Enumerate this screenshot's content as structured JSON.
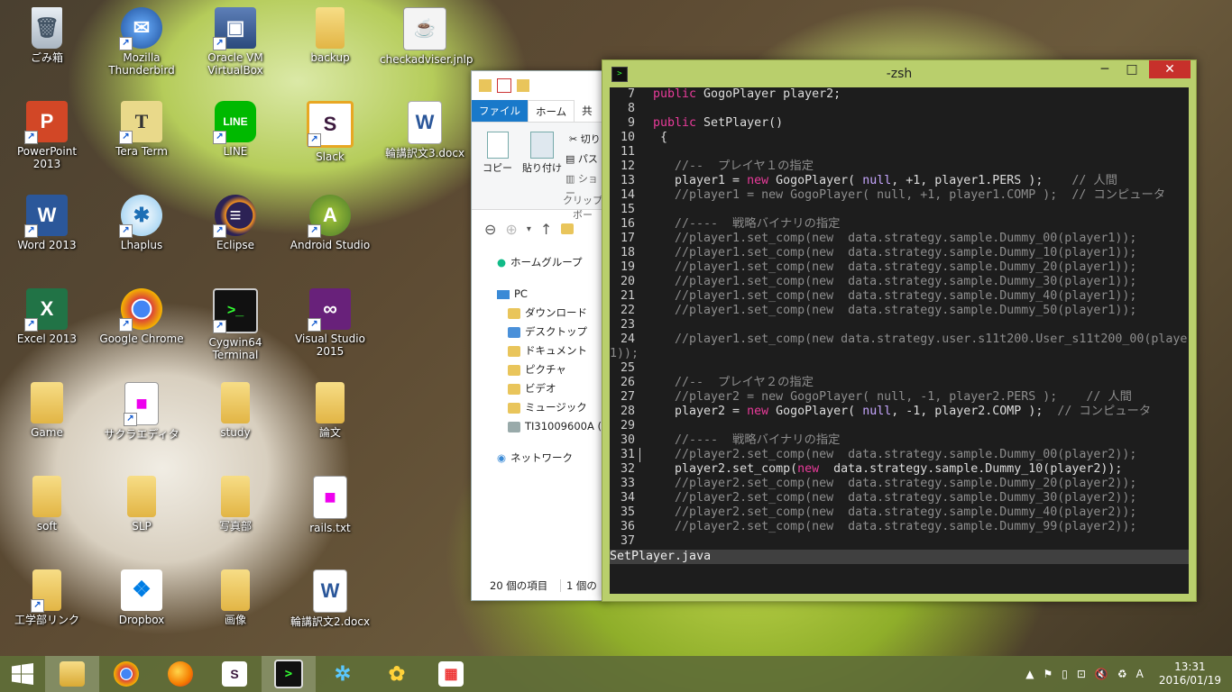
{
  "desktop_icons": [
    {
      "label": "ごみ箱",
      "icon": "recycle-bin-icon"
    },
    {
      "label": "Mozilla Thunderbird",
      "icon": "thunderbird-icon"
    },
    {
      "label": "Oracle VM VirtualBox",
      "icon": "virtualbox-icon"
    },
    {
      "label": "backup",
      "icon": "folder-icon"
    },
    {
      "label": "checkadviser.jnlp",
      "icon": "java-icon"
    },
    {
      "label": "PowerPoint 2013",
      "icon": "powerpoint-icon"
    },
    {
      "label": "Tera Term",
      "icon": "teraterm-icon"
    },
    {
      "label": "LINE",
      "icon": "line-icon"
    },
    {
      "label": "Slack",
      "icon": "slack-icon"
    },
    {
      "label": "輪講訳文3.docx",
      "icon": "word-doc-icon"
    },
    {
      "label": "Word 2013",
      "icon": "word-icon"
    },
    {
      "label": "Lhaplus",
      "icon": "lhaplus-icon"
    },
    {
      "label": "Eclipse",
      "icon": "eclipse-icon"
    },
    {
      "label": "Android Studio",
      "icon": "android-studio-icon"
    },
    {
      "label": "Excel 2013",
      "icon": "excel-icon"
    },
    {
      "label": "Google Chrome",
      "icon": "chrome-icon"
    },
    {
      "label": "Cygwin64 Terminal",
      "icon": "cygwin-icon"
    },
    {
      "label": "Visual Studio 2015",
      "icon": "visual-studio-icon"
    },
    {
      "label": "Game",
      "icon": "folder-icon"
    },
    {
      "label": "サクラエディタ",
      "icon": "sakura-editor-icon"
    },
    {
      "label": "study",
      "icon": "folder-icon"
    },
    {
      "label": "論文",
      "icon": "folder-icon"
    },
    {
      "label": "soft",
      "icon": "folder-icon"
    },
    {
      "label": "SLP",
      "icon": "folder-icon"
    },
    {
      "label": "写真部",
      "icon": "folder-icon"
    },
    {
      "label": "rails.txt",
      "icon": "text-file-icon"
    },
    {
      "label": "工学部リンク",
      "icon": "folder-icon"
    },
    {
      "label": "Dropbox",
      "icon": "dropbox-icon"
    },
    {
      "label": "画像",
      "icon": "folder-icon"
    },
    {
      "label": "輪講訳文2.docx",
      "icon": "word-doc-icon"
    }
  ],
  "explorer": {
    "tabs": [
      "ファイル",
      "ホーム",
      "共"
    ],
    "ribbon": {
      "copy": "コピー",
      "paste": "貼り付け",
      "cut": "切り",
      "path": "パス",
      "shortcut": "ショー",
      "group": "クリップボー"
    },
    "homegroup": "ホームグループ",
    "pc": "PC",
    "tree": [
      "ダウンロード",
      "デスクトップ",
      "ドキュメント",
      "ピクチャ",
      "ビデオ",
      "ミュージック",
      "TI31009600A ("
    ],
    "network": "ネットワーク",
    "status_count": "20 個の項目",
    "status_selected": "1 個の"
  },
  "terminal": {
    "title": "-zsh",
    "status_file": "SetPlayer.java",
    "lines": [
      {
        "n": "7",
        "t": "public GogoPlayer player2;"
      },
      {
        "n": "8",
        "t": ""
      },
      {
        "n": "9",
        "t": "public SetPlayer()"
      },
      {
        "n": "10",
        "t": " {"
      },
      {
        "n": "11",
        "t": ""
      },
      {
        "n": "12",
        "t": "   //--  プレイヤ１の指定"
      },
      {
        "n": "13",
        "t": "   player1 = new GogoPlayer( null, +1, player1.PERS );    // 人間"
      },
      {
        "n": "14",
        "t": "   //player1 = new GogoPlayer( null, +1, player1.COMP );  // コンピュータ"
      },
      {
        "n": "15",
        "t": ""
      },
      {
        "n": "16",
        "t": "   //----  戦略バイナリの指定"
      },
      {
        "n": "17",
        "t": "   //player1.set_comp(new  data.strategy.sample.Dummy_00(player1));"
      },
      {
        "n": "18",
        "t": "   //player1.set_comp(new  data.strategy.sample.Dummy_10(player1));"
      },
      {
        "n": "19",
        "t": "   //player1.set_comp(new  data.strategy.sample.Dummy_20(player1));"
      },
      {
        "n": "20",
        "t": "   //player1.set_comp(new  data.strategy.sample.Dummy_30(player1));"
      },
      {
        "n": "21",
        "t": "   //player1.set_comp(new  data.strategy.sample.Dummy_40(player1));"
      },
      {
        "n": "22",
        "t": "   //player1.set_comp(new  data.strategy.sample.Dummy_50(player1));"
      },
      {
        "n": "23",
        "t": ""
      },
      {
        "n": "24",
        "t": "   //player1.set_comp(new data.strategy.user.s11t200.User_s11t200_00(player"
      },
      {
        "n": "",
        "t": "1));"
      },
      {
        "n": "25",
        "t": ""
      },
      {
        "n": "26",
        "t": "   //--  プレイヤ２の指定"
      },
      {
        "n": "27",
        "t": "   //player2 = new GogoPlayer( null, -1, player2.PERS );    // 人間"
      },
      {
        "n": "28",
        "t": "   player2 = new GogoPlayer( null, -1, player2.COMP );  // コンピュータ"
      },
      {
        "n": "29",
        "t": ""
      },
      {
        "n": "30",
        "t": "   //----  戦略バイナリの指定"
      },
      {
        "n": "31",
        "t": "   //player2.set_comp(new  data.strategy.sample.Dummy_00(player2));"
      },
      {
        "n": "32",
        "t": "   player2.set_comp(new  data.strategy.sample.Dummy_10(player2));"
      },
      {
        "n": "33",
        "t": "   //player2.set_comp(new  data.strategy.sample.Dummy_20(player2));"
      },
      {
        "n": "34",
        "t": "   //player2.set_comp(new  data.strategy.sample.Dummy_30(player2));"
      },
      {
        "n": "35",
        "t": "   //player2.set_comp(new  data.strategy.sample.Dummy_40(player2));"
      },
      {
        "n": "36",
        "t": "   //player2.set_comp(new  data.strategy.sample.Dummy_99(player2));"
      },
      {
        "n": "37",
        "t": ""
      }
    ]
  },
  "taskbar": {
    "items": [
      "file-explorer-icon",
      "chrome-icon",
      "firefox-icon",
      "slack-icon",
      "cygwin-terminal-icon",
      "network-app-icon",
      "flower-app-icon",
      "apps-grid-icon"
    ],
    "ime": "A",
    "time": "13:31",
    "date": "2016/01/19"
  }
}
